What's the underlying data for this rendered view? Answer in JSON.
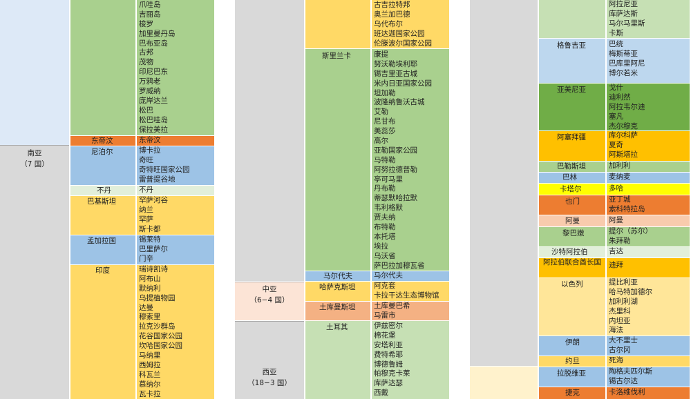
{
  "colors": {
    "green": "#a9d08e",
    "light_green": "#c6e0b4",
    "blue": "#9dc3e6",
    "light_blue": "#bdd7ee",
    "yellow": "#ffd966",
    "light_yellow": "#ffe699",
    "orange": "#ed7d31",
    "salmon": "#f4b183",
    "gray": "#d9d9d9",
    "bright_yellow": "#ffff00",
    "pink": "#f8cbad"
  },
  "panel1": {
    "region_south_asia": "南亚",
    "region_south_asia_count": "（7 国）",
    "indonesia_sites": [
      "爪哇岛",
      "吉丽岛",
      "梭罗",
      "加里曼丹岛",
      "巴布亚岛",
      "古邦",
      "茂物",
      "印尼巴东",
      "万鸦老",
      "罗威纳",
      "庞岸达兰",
      "松巴",
      "松巴哇岛",
      "保拉美拉"
    ],
    "east_timor": {
      "country": "东帝汶",
      "sites": [
        "东帝汶"
      ]
    },
    "nepal": {
      "country": "尼泊尔",
      "sites": [
        "博卡拉",
        "奇旺",
        "奇特旺国家公园",
        "雷普提谷地"
      ]
    },
    "bhutan": {
      "country": "不丹",
      "sites": [
        "不丹"
      ]
    },
    "pakistan": {
      "country": "巴基斯坦",
      "sites": [
        "罕萨河谷",
        "纳兰",
        "罕萨",
        "斯卡都"
      ]
    },
    "bangladesh": {
      "country": "孟加拉国",
      "sites": [
        "锡莱特",
        "巴里萨尔",
        "门辛"
      ]
    },
    "india": {
      "country": "印度",
      "sites": [
        "瑞诗凯诗",
        "阿布山",
        "默纳利",
        "乌提植物园",
        "达曼",
        "穆索里",
        "拉克沙群岛",
        "花谷国家公园",
        "坎哈国家公园",
        "马纳里",
        "西姆拉",
        "科瓦兰",
        "慕纳尔",
        "瓦卡拉"
      ]
    }
  },
  "panel2": {
    "top_sites": [
      "古吉拉特邦",
      "奥兰加巴德",
      "乌代布尔",
      "班达迦国家公园",
      "伦滕波尔国家公园"
    ],
    "sri_lanka": {
      "country": "斯里兰卡",
      "sites": [
        "康提",
        "努沃勒埃利耶",
        "锡吉里亚古城",
        "米内日亚国家公园",
        "坦加勒",
        "波隆纳鲁沃古城",
        "艾勒",
        "尼甘布",
        "美蕊莎",
        "高尔",
        "亚勒国家公园",
        "马特勒",
        "阿努拉德普勒",
        "亭可马里",
        "丹布勒",
        "蒂瑟默哈拉默",
        "韦利格默",
        "贾夫纳",
        "布特勒",
        "本托塔",
        "埃拉",
        "乌沃省",
        "萨巴拉加穆瓦省"
      ]
    },
    "maldives": {
      "country": "马尔代夫",
      "sites": [
        "马尔代夫"
      ]
    },
    "region_central_asia": "中亚",
    "region_central_asia_count": "（6−4 国）",
    "kazakhstan": {
      "country": "哈萨克斯坦",
      "sites": [
        "阿克套",
        "卡拉干达生态博物馆"
      ]
    },
    "turkmenistan": {
      "country": "土库曼斯坦",
      "sites": [
        "土库曼巴希",
        "马雷市"
      ]
    },
    "region_west_asia": "西亚",
    "region_west_asia_count": "（18−3 国）",
    "turkey": {
      "country": "土耳其",
      "sites": [
        "伊兹密尔",
        "棉花堡",
        "安塔利亚",
        "费特希耶",
        "博德鲁姆",
        "帕穆克卡莱",
        "库萨达瑟",
        "西戴"
      ]
    }
  },
  "panel3": {
    "top_sites": [
      "阿拉尼亚",
      "库萨达斯",
      "马尔马里斯",
      "卡斯"
    ],
    "georgia": {
      "country": "格鲁吉亚",
      "sites": [
        "巴统",
        "梅斯蒂亚",
        "巴库里阿尼",
        "博尔若米"
      ]
    },
    "armenia": {
      "country": "亚美尼亚",
      "sites": [
        "戈什",
        "迪利然",
        "阿拉韦尔迪",
        "塞凡",
        "杰尔穆克"
      ]
    },
    "azerbaijan": {
      "country": "阿塞拜疆",
      "sites": [
        "库尔科萨",
        "夏奇",
        "阿斯塔拉"
      ]
    },
    "palestine": {
      "country": "巴勒斯坦",
      "sites": [
        "加利利"
      ]
    },
    "bahrain": {
      "country": "巴林",
      "sites": [
        "麦纳麦"
      ]
    },
    "qatar": {
      "country": "卡塔尔",
      "sites": [
        "多哈"
      ]
    },
    "yemen": {
      "country": "也门",
      "sites": [
        "亚丁城",
        "索科特拉岛"
      ]
    },
    "oman": {
      "country": "阿曼",
      "sites": [
        "阿曼"
      ]
    },
    "lebanon": {
      "country": "黎巴嫩",
      "sites": [
        "提尔（苏尔）",
        "朱拜勒"
      ]
    },
    "saudi": {
      "country": "沙特阿拉伯",
      "sites": [
        "吉达"
      ]
    },
    "uae": {
      "country": "阿拉伯联合酋长国",
      "sites": [
        "迪拜"
      ]
    },
    "israel": {
      "country": "以色列",
      "sites": [
        "提比利亚",
        "哈马特加德尔",
        "加利利湖",
        "杰里科",
        "内坦亚",
        "海法"
      ]
    },
    "iran": {
      "country": "伊朗",
      "sites": [
        "大不里士",
        "古尔冈"
      ]
    },
    "jordan": {
      "country": "约旦",
      "sites": [
        "死海"
      ]
    },
    "latvia": {
      "country": "拉脱维亚",
      "sites": [
        "陶格夫匹尔斯",
        "锡古尔达"
      ]
    },
    "czech": {
      "country": "捷克",
      "sites": [
        "卡洛维伐利"
      ]
    }
  }
}
